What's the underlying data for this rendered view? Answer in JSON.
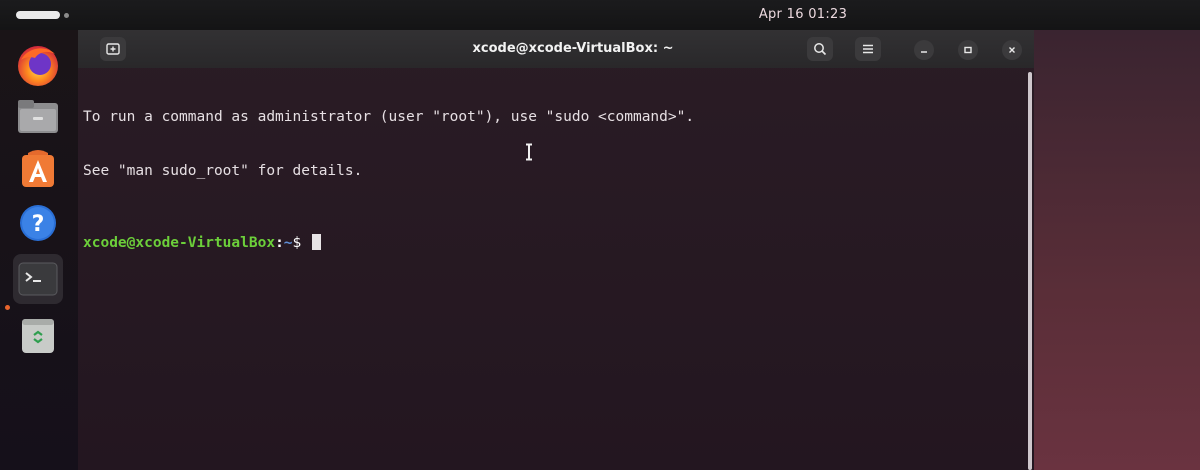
{
  "topbar": {
    "clock": "Apr 16 01:23"
  },
  "dock": {
    "items": [
      {
        "name": "firefox",
        "icon": "firefox-icon"
      },
      {
        "name": "files",
        "icon": "folder-icon"
      },
      {
        "name": "app-center",
        "icon": "app-store-icon"
      },
      {
        "name": "help",
        "icon": "help-icon"
      },
      {
        "name": "terminal",
        "icon": "terminal-icon",
        "active": true
      },
      {
        "name": "trash",
        "icon": "trash-icon"
      }
    ]
  },
  "terminal": {
    "title": "xcode@xcode-VirtualBox: ~",
    "lines": [
      "To run a command as administrator (user \"root\"), use \"sudo <command>\".",
      "See \"man sudo_root\" for details."
    ],
    "prompt": {
      "user_host": "xcode@xcode-VirtualBox",
      "separator": ":",
      "directory": "~",
      "symbol": "$ "
    },
    "icons": {
      "new_tab": "new-tab-icon",
      "search": "search-icon",
      "menu": "hamburger-menu-icon",
      "minimize": "minimize-icon",
      "maximize": "maximize-icon",
      "close": "close-icon"
    }
  },
  "colors": {
    "prompt_user": "#6ccf3a",
    "prompt_dir": "#5f8ed6",
    "terminal_bg": "#2a1c25",
    "titlebar_bg": "#2d2d2f"
  }
}
